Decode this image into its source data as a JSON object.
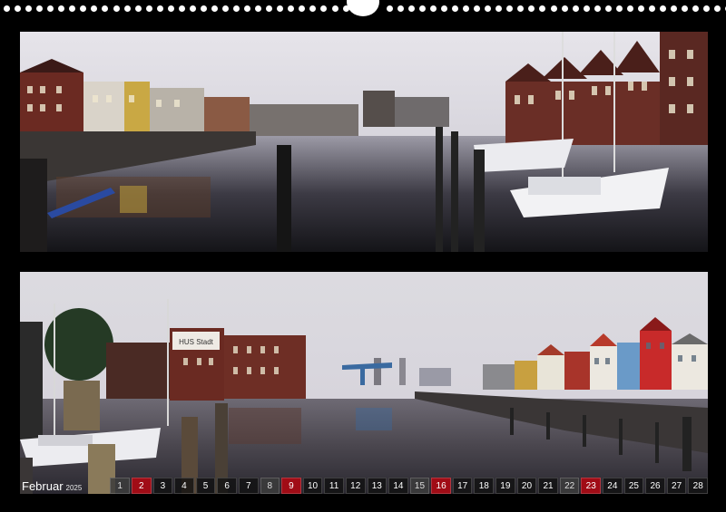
{
  "calendar": {
    "month": "Februar",
    "year": "2025",
    "days": [
      {
        "d": "1",
        "type": "saturday"
      },
      {
        "d": "2",
        "type": "sunday"
      },
      {
        "d": "3",
        "type": "weekday"
      },
      {
        "d": "4",
        "type": "weekday"
      },
      {
        "d": "5",
        "type": "weekday"
      },
      {
        "d": "6",
        "type": "weekday"
      },
      {
        "d": "7",
        "type": "weekday"
      },
      {
        "d": "8",
        "type": "saturday"
      },
      {
        "d": "9",
        "type": "sunday"
      },
      {
        "d": "10",
        "type": "weekday"
      },
      {
        "d": "11",
        "type": "weekday"
      },
      {
        "d": "12",
        "type": "weekday"
      },
      {
        "d": "13",
        "type": "weekday"
      },
      {
        "d": "14",
        "type": "weekday"
      },
      {
        "d": "15",
        "type": "saturday"
      },
      {
        "d": "16",
        "type": "sunday"
      },
      {
        "d": "17",
        "type": "weekday"
      },
      {
        "d": "18",
        "type": "weekday"
      },
      {
        "d": "19",
        "type": "weekday"
      },
      {
        "d": "20",
        "type": "weekday"
      },
      {
        "d": "21",
        "type": "weekday"
      },
      {
        "d": "22",
        "type": "saturday"
      },
      {
        "d": "23",
        "type": "sunday"
      },
      {
        "d": "24",
        "type": "weekday"
      },
      {
        "d": "25",
        "type": "weekday"
      },
      {
        "d": "26",
        "type": "weekday"
      },
      {
        "d": "27",
        "type": "weekday"
      },
      {
        "d": "28",
        "type": "weekday"
      }
    ]
  },
  "photos": {
    "top_sign_text": "",
    "bottom_sign_text": "HUS Stadt"
  },
  "colors": {
    "background": "#000000",
    "sunday": "#aa0a14",
    "binding": "#ffffff"
  }
}
